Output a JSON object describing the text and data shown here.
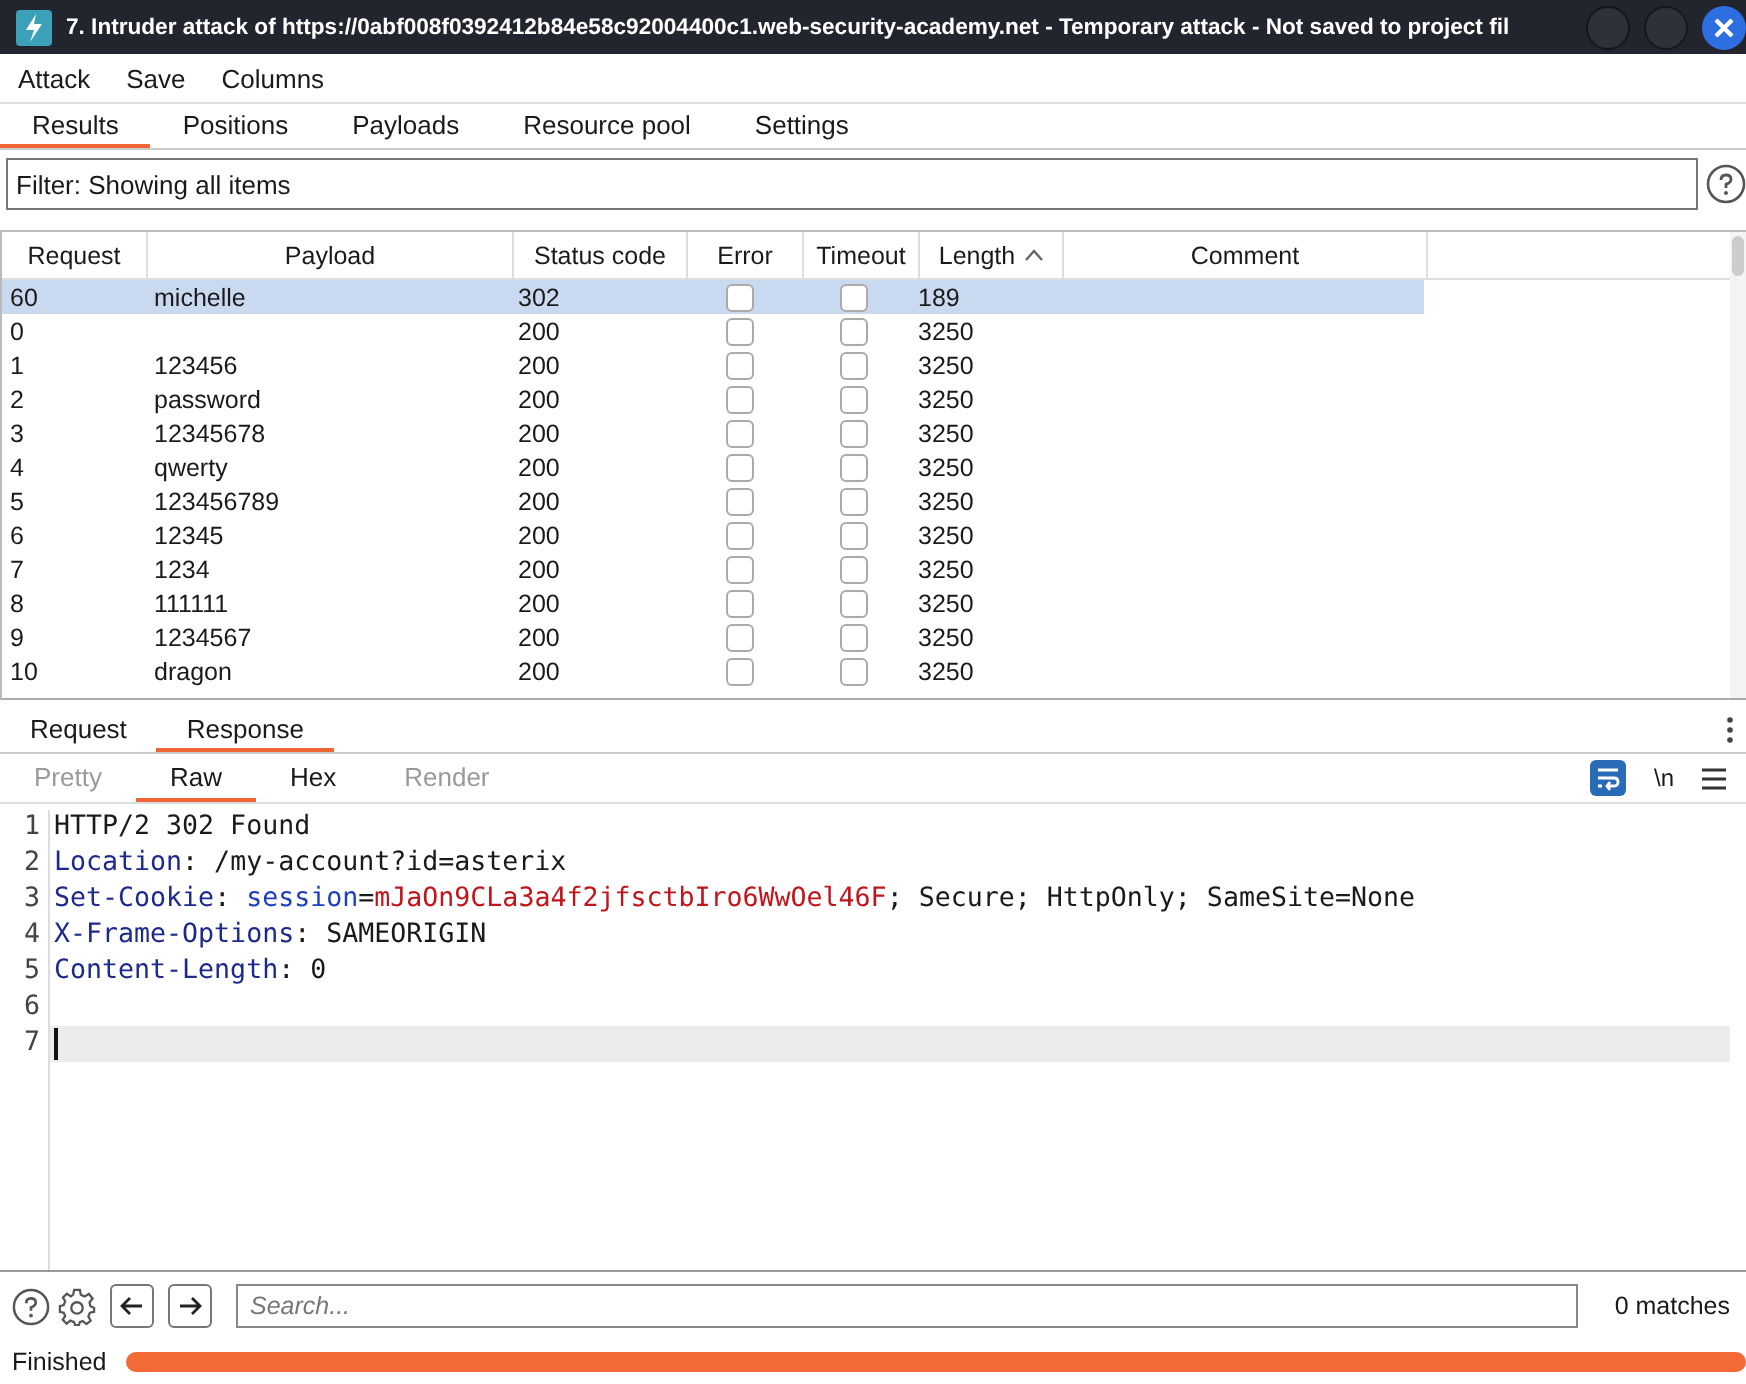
{
  "window": {
    "title": "7. Intruder attack of https://0abf008f0392412b84e58c92004400c1.web-security-academy.net - Temporary attack - Not saved to project fil"
  },
  "menu": [
    "Attack",
    "Save",
    "Columns"
  ],
  "tabs": [
    {
      "label": "Results",
      "selected": true
    },
    {
      "label": "Positions",
      "selected": false
    },
    {
      "label": "Payloads",
      "selected": false
    },
    {
      "label": "Resource pool",
      "selected": false
    },
    {
      "label": "Settings",
      "selected": false
    }
  ],
  "filter": "Filter: Showing all items",
  "table": {
    "columns": [
      {
        "label": "Request",
        "sorted": false
      },
      {
        "label": "Payload",
        "sorted": false
      },
      {
        "label": "Status code",
        "sorted": false
      },
      {
        "label": "Error",
        "sorted": false
      },
      {
        "label": "Timeout",
        "sorted": false
      },
      {
        "label": "Length",
        "sorted": true
      },
      {
        "label": "Comment",
        "sorted": false
      }
    ],
    "rows": [
      {
        "request": "60",
        "payload": "michelle",
        "status": "302",
        "error": false,
        "timeout": false,
        "length": "189",
        "selected": true
      },
      {
        "request": "0",
        "payload": "",
        "status": "200",
        "error": false,
        "timeout": false,
        "length": "3250",
        "selected": false
      },
      {
        "request": "1",
        "payload": "123456",
        "status": "200",
        "error": false,
        "timeout": false,
        "length": "3250",
        "selected": false
      },
      {
        "request": "2",
        "payload": "password",
        "status": "200",
        "error": false,
        "timeout": false,
        "length": "3250",
        "selected": false
      },
      {
        "request": "3",
        "payload": "12345678",
        "status": "200",
        "error": false,
        "timeout": false,
        "length": "3250",
        "selected": false
      },
      {
        "request": "4",
        "payload": "qwerty",
        "status": "200",
        "error": false,
        "timeout": false,
        "length": "3250",
        "selected": false
      },
      {
        "request": "5",
        "payload": "123456789",
        "status": "200",
        "error": false,
        "timeout": false,
        "length": "3250",
        "selected": false
      },
      {
        "request": "6",
        "payload": "12345",
        "status": "200",
        "error": false,
        "timeout": false,
        "length": "3250",
        "selected": false
      },
      {
        "request": "7",
        "payload": "1234",
        "status": "200",
        "error": false,
        "timeout": false,
        "length": "3250",
        "selected": false
      },
      {
        "request": "8",
        "payload": "111111",
        "status": "200",
        "error": false,
        "timeout": false,
        "length": "3250",
        "selected": false
      },
      {
        "request": "9",
        "payload": "1234567",
        "status": "200",
        "error": false,
        "timeout": false,
        "length": "3250",
        "selected": false
      },
      {
        "request": "10",
        "payload": "dragon",
        "status": "200",
        "error": false,
        "timeout": false,
        "length": "3250",
        "selected": false
      }
    ]
  },
  "message_tabs": [
    {
      "label": "Request",
      "selected": false
    },
    {
      "label": "Response",
      "selected": true
    }
  ],
  "view_tabs": [
    {
      "label": "Pretty",
      "selected": false,
      "disabled": true
    },
    {
      "label": "Raw",
      "selected": true,
      "disabled": false
    },
    {
      "label": "Hex",
      "selected": false,
      "disabled": false
    },
    {
      "label": "Render",
      "selected": false,
      "disabled": true
    }
  ],
  "newline_toggle": "\\n",
  "editor": {
    "lines": [
      {
        "number": "1",
        "segments": [
          {
            "kind": "plain",
            "text": "HTTP/2 302 Found"
          }
        ],
        "current": false
      },
      {
        "number": "2",
        "segments": [
          {
            "kind": "key",
            "text": "Location"
          },
          {
            "kind": "plain",
            "text": ": /my-account?id=asterix"
          }
        ],
        "current": false
      },
      {
        "number": "3",
        "segments": [
          {
            "kind": "key",
            "text": "Set-Cookie"
          },
          {
            "kind": "plain",
            "text": ": "
          },
          {
            "kind": "name",
            "text": "session"
          },
          {
            "kind": "plain",
            "text": "="
          },
          {
            "kind": "value",
            "text": "mJaOn9CLa3a4f2jfsctbIro6WwOel46F"
          },
          {
            "kind": "plain",
            "text": "; Secure; HttpOnly; SameSite=None"
          }
        ],
        "current": false
      },
      {
        "number": "4",
        "segments": [
          {
            "kind": "key",
            "text": "X-Frame-Options"
          },
          {
            "kind": "plain",
            "text": ": SAMEORIGIN"
          }
        ],
        "current": false
      },
      {
        "number": "5",
        "segments": [
          {
            "kind": "key",
            "text": "Content-Length"
          },
          {
            "kind": "plain",
            "text": ": 0"
          }
        ],
        "current": false
      },
      {
        "number": "6",
        "current": false
      },
      {
        "number": "7",
        "current": true
      }
    ]
  },
  "search": {
    "placeholder": "Search...",
    "matches": "0 matches"
  },
  "status_bar": {
    "text": "Finished",
    "level": 1
  }
}
